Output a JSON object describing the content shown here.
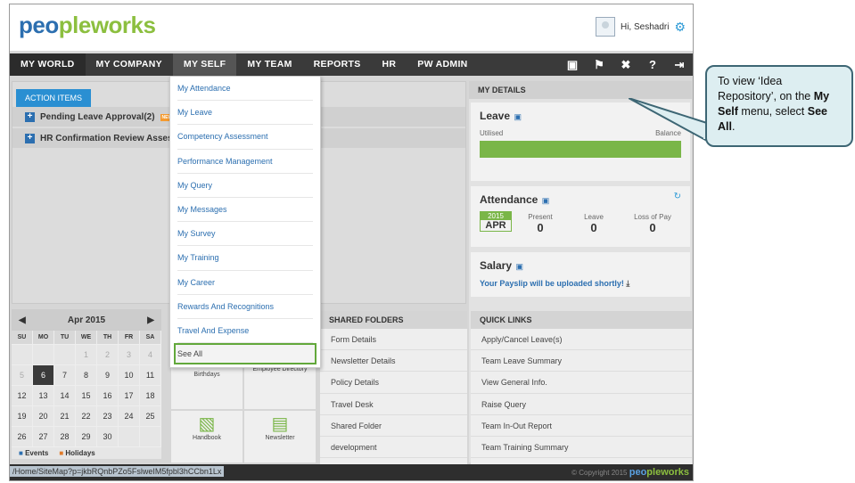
{
  "app": {
    "logo_a": "peo",
    "logo_b": "ple",
    "logo_c": "works"
  },
  "user": {
    "greeting": "Hi, Seshadri"
  },
  "nav": {
    "items": [
      "MY WORLD",
      "MY COMPANY",
      "MY SELF",
      "MY TEAM",
      "REPORTS",
      "HR",
      "PW ADMIN"
    ],
    "icons": [
      "book-icon",
      "flag-icon",
      "tools-icon",
      "help-icon",
      "logout-icon"
    ]
  },
  "action_items": {
    "tab": "ACTION ITEMS",
    "rows": [
      "Pending Leave Approval(2)",
      "HR Confirmation Review Assessm"
    ],
    "badge": "NEW"
  },
  "my_self_menu": [
    "My Attendance",
    "My Leave",
    "Competency Assessment",
    "Performance Management",
    "My Query",
    "My Messages",
    "My Survey",
    "My Training",
    "My Career",
    "Rewards And Recognitions",
    "Travel And Expense",
    "See All"
  ],
  "my_details": {
    "title": "MY DETAILS",
    "leave": {
      "title": "Leave",
      "utilised": "Utilised",
      "balance": "Balance"
    },
    "attendance": {
      "title": "Attendance",
      "year": "2015",
      "month": "APR",
      "present_label": "Present",
      "present": "0",
      "leave_label": "Leave",
      "leave": "0",
      "lop_label": "Loss of Pay",
      "lop": "0"
    },
    "salary": {
      "title": "Salary",
      "note": "Your Payslip will be uploaded shortly!"
    }
  },
  "calendar": {
    "month": "Apr 2015",
    "dow": [
      "SU",
      "MO",
      "TU",
      "WE",
      "TH",
      "FR",
      "SA"
    ],
    "rows": [
      [
        "",
        "",
        "",
        "1",
        "2",
        "3",
        "4"
      ],
      [
        "5",
        "6",
        "7",
        "8",
        "9",
        "10",
        "11"
      ],
      [
        "12",
        "13",
        "14",
        "15",
        "16",
        "17",
        "18"
      ],
      [
        "19",
        "20",
        "21",
        "22",
        "23",
        "24",
        "25"
      ],
      [
        "26",
        "27",
        "28",
        "29",
        "30",
        "",
        ""
      ]
    ],
    "legend": [
      "Events",
      "Holidays"
    ]
  },
  "tiles": [
    "Birthdays",
    "Employee Directory",
    "Handbook",
    "Newsletter"
  ],
  "shared_folders": {
    "title": "SHARED FOLDERS",
    "items": [
      "Form Details",
      "Newsletter Details",
      "Policy Details",
      "Travel Desk",
      "Shared Folder",
      "development"
    ]
  },
  "quick_links": {
    "title": "QUICK LINKS",
    "items": [
      "Apply/Cancel Leave(s)",
      "Team Leave Summary",
      "View General Info.",
      "Raise Query",
      "Team In-Out Report",
      "Team Training Summary"
    ]
  },
  "footer": {
    "url": "/Home/SiteMap?p=jkbRQnbPZo5FslweIM5fpbl3hCCbn1Lx",
    "copyright": "© Copyright 2015"
  },
  "callout": {
    "line1": "To view ‘Idea Repository’, on the",
    "bold1": "My Self",
    "line2": " menu, select ",
    "bold2": "See All",
    "line3": "."
  },
  "colors": {
    "accent": "#2c6fb0",
    "green": "#7ab648",
    "navbar": "#3a3a3a",
    "highlight": "#62a83b"
  }
}
